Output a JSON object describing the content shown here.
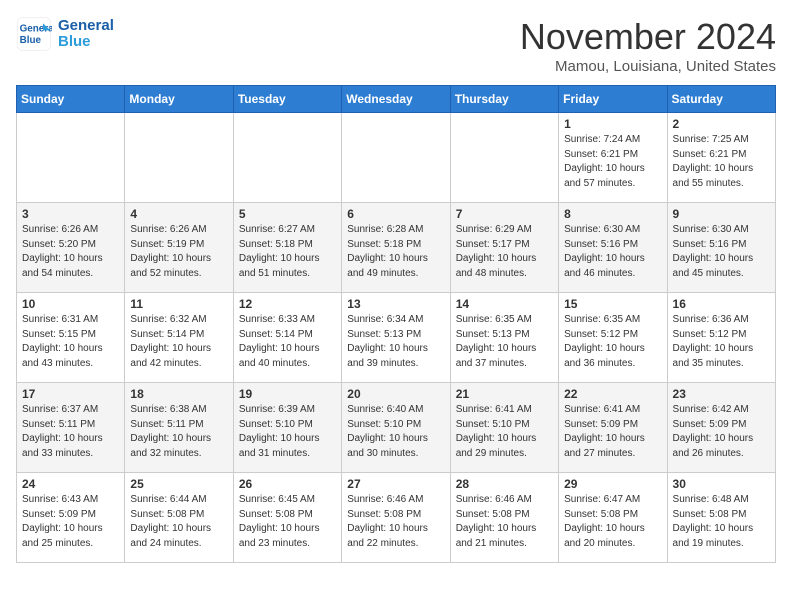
{
  "header": {
    "logo_line1": "General",
    "logo_line2": "Blue",
    "month": "November 2024",
    "location": "Mamou, Louisiana, United States"
  },
  "weekdays": [
    "Sunday",
    "Monday",
    "Tuesday",
    "Wednesday",
    "Thursday",
    "Friday",
    "Saturday"
  ],
  "weeks": [
    [
      {
        "day": "",
        "info": ""
      },
      {
        "day": "",
        "info": ""
      },
      {
        "day": "",
        "info": ""
      },
      {
        "day": "",
        "info": ""
      },
      {
        "day": "",
        "info": ""
      },
      {
        "day": "1",
        "info": "Sunrise: 7:24 AM\nSunset: 6:21 PM\nDaylight: 10 hours\nand 57 minutes."
      },
      {
        "day": "2",
        "info": "Sunrise: 7:25 AM\nSunset: 6:21 PM\nDaylight: 10 hours\nand 55 minutes."
      }
    ],
    [
      {
        "day": "3",
        "info": "Sunrise: 6:26 AM\nSunset: 5:20 PM\nDaylight: 10 hours\nand 54 minutes."
      },
      {
        "day": "4",
        "info": "Sunrise: 6:26 AM\nSunset: 5:19 PM\nDaylight: 10 hours\nand 52 minutes."
      },
      {
        "day": "5",
        "info": "Sunrise: 6:27 AM\nSunset: 5:18 PM\nDaylight: 10 hours\nand 51 minutes."
      },
      {
        "day": "6",
        "info": "Sunrise: 6:28 AM\nSunset: 5:18 PM\nDaylight: 10 hours\nand 49 minutes."
      },
      {
        "day": "7",
        "info": "Sunrise: 6:29 AM\nSunset: 5:17 PM\nDaylight: 10 hours\nand 48 minutes."
      },
      {
        "day": "8",
        "info": "Sunrise: 6:30 AM\nSunset: 5:16 PM\nDaylight: 10 hours\nand 46 minutes."
      },
      {
        "day": "9",
        "info": "Sunrise: 6:30 AM\nSunset: 5:16 PM\nDaylight: 10 hours\nand 45 minutes."
      }
    ],
    [
      {
        "day": "10",
        "info": "Sunrise: 6:31 AM\nSunset: 5:15 PM\nDaylight: 10 hours\nand 43 minutes."
      },
      {
        "day": "11",
        "info": "Sunrise: 6:32 AM\nSunset: 5:14 PM\nDaylight: 10 hours\nand 42 minutes."
      },
      {
        "day": "12",
        "info": "Sunrise: 6:33 AM\nSunset: 5:14 PM\nDaylight: 10 hours\nand 40 minutes."
      },
      {
        "day": "13",
        "info": "Sunrise: 6:34 AM\nSunset: 5:13 PM\nDaylight: 10 hours\nand 39 minutes."
      },
      {
        "day": "14",
        "info": "Sunrise: 6:35 AM\nSunset: 5:13 PM\nDaylight: 10 hours\nand 37 minutes."
      },
      {
        "day": "15",
        "info": "Sunrise: 6:35 AM\nSunset: 5:12 PM\nDaylight: 10 hours\nand 36 minutes."
      },
      {
        "day": "16",
        "info": "Sunrise: 6:36 AM\nSunset: 5:12 PM\nDaylight: 10 hours\nand 35 minutes."
      }
    ],
    [
      {
        "day": "17",
        "info": "Sunrise: 6:37 AM\nSunset: 5:11 PM\nDaylight: 10 hours\nand 33 minutes."
      },
      {
        "day": "18",
        "info": "Sunrise: 6:38 AM\nSunset: 5:11 PM\nDaylight: 10 hours\nand 32 minutes."
      },
      {
        "day": "19",
        "info": "Sunrise: 6:39 AM\nSunset: 5:10 PM\nDaylight: 10 hours\nand 31 minutes."
      },
      {
        "day": "20",
        "info": "Sunrise: 6:40 AM\nSunset: 5:10 PM\nDaylight: 10 hours\nand 30 minutes."
      },
      {
        "day": "21",
        "info": "Sunrise: 6:41 AM\nSunset: 5:10 PM\nDaylight: 10 hours\nand 29 minutes."
      },
      {
        "day": "22",
        "info": "Sunrise: 6:41 AM\nSunset: 5:09 PM\nDaylight: 10 hours\nand 27 minutes."
      },
      {
        "day": "23",
        "info": "Sunrise: 6:42 AM\nSunset: 5:09 PM\nDaylight: 10 hours\nand 26 minutes."
      }
    ],
    [
      {
        "day": "24",
        "info": "Sunrise: 6:43 AM\nSunset: 5:09 PM\nDaylight: 10 hours\nand 25 minutes."
      },
      {
        "day": "25",
        "info": "Sunrise: 6:44 AM\nSunset: 5:08 PM\nDaylight: 10 hours\nand 24 minutes."
      },
      {
        "day": "26",
        "info": "Sunrise: 6:45 AM\nSunset: 5:08 PM\nDaylight: 10 hours\nand 23 minutes."
      },
      {
        "day": "27",
        "info": "Sunrise: 6:46 AM\nSunset: 5:08 PM\nDaylight: 10 hours\nand 22 minutes."
      },
      {
        "day": "28",
        "info": "Sunrise: 6:46 AM\nSunset: 5:08 PM\nDaylight: 10 hours\nand 21 minutes."
      },
      {
        "day": "29",
        "info": "Sunrise: 6:47 AM\nSunset: 5:08 PM\nDaylight: 10 hours\nand 20 minutes."
      },
      {
        "day": "30",
        "info": "Sunrise: 6:48 AM\nSunset: 5:08 PM\nDaylight: 10 hours\nand 19 minutes."
      }
    ]
  ]
}
